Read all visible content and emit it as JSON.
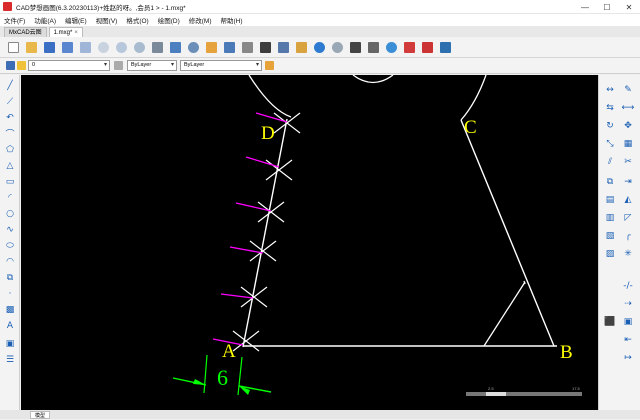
{
  "window": {
    "title": "CAD梦想画图(6.3.20230113)+姓赵的呀。,会员1 > - 1.mxg*",
    "minimize": "—",
    "maximize": "☐",
    "close": "✕"
  },
  "menu": [
    "文件(F)",
    "功能(A)",
    "编辑(E)",
    "视图(V)",
    "格式(O)",
    "绘图(D)",
    "修改(M)",
    "帮助(H)"
  ],
  "tabs": [
    {
      "label": "MxCAD云图",
      "active": false
    },
    {
      "label": "1.mxg*",
      "active": true,
      "close": "×"
    }
  ],
  "toolbar": {
    "layer_value": "0",
    "color_value": "ByLayer",
    "linetype_value": "ByLayer",
    "icons": [
      "new-icon",
      "open-icon",
      "save-icon",
      "saveas-icon",
      "print-preview-icon",
      "zoom-icon",
      "zoom-window-icon",
      "zoom-extents-icon",
      "pan-icon",
      "measure-icon",
      "find-icon",
      "edit-icon",
      "table-icon",
      "image-icon",
      "block-icon",
      "properties-icon",
      "match-icon",
      "undo-icon",
      "redo-icon",
      "plot-icon",
      "print-icon",
      "web-icon",
      "pdf-icon",
      "export-icon",
      "gallery-icon"
    ]
  },
  "drawing": {
    "labels": {
      "A": "A",
      "B": "B",
      "C": "C",
      "D": "D",
      "dim": "6"
    },
    "colors": {
      "line": "#ffffff",
      "label": "#ffff00",
      "magenta": "#ff00ff",
      "dim": "#00ff00"
    }
  },
  "scale_bar": {
    "left": "0",
    "mid": "2.5",
    "right": "17.5"
  },
  "status": {
    "model_tab": "模型"
  }
}
